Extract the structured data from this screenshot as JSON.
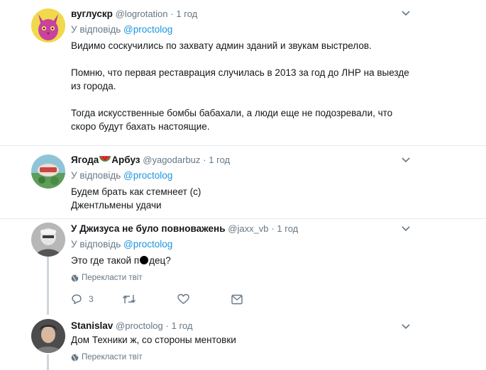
{
  "tweets": [
    {
      "name": "вуглускр",
      "handle": "@logrotation",
      "time": "1 год",
      "reply_prefix": "У відповідь",
      "reply_to": "@proctolog",
      "paragraphs": [
        "Видимо соскучились по захвату админ зданий и звукам выстрелов.",
        "Помню, что первая реставрация случилась в 2013 за год до ЛНР на выезде из города.",
        "Тогда искусственные бомбы бабахали, а люди еще не подозревали, что скоро будут бахать настоящие."
      ]
    },
    {
      "name_part1": "Ягода",
      "name_part2": "Арбуз",
      "handle": "@yagodarbuz",
      "time": "1 год",
      "reply_prefix": "У відповідь",
      "reply_to": "@proctolog",
      "lines": [
        "Будем брать как стемнеет (с)",
        "Джентльмены удачи"
      ]
    },
    {
      "name": "У Джизуса не було повноважень",
      "handle": "@jaxx_vb",
      "time": "1 год",
      "reply_prefix": "У відповідь",
      "reply_to": "@proctolog",
      "text_before": "Это где такой п",
      "text_after": "дец?",
      "translate": "Перекласти твіт",
      "reply_count": "3"
    },
    {
      "name": "Stanislav",
      "handle": "@proctolog",
      "time": "1 год",
      "text": "Дом Техники ж, со стороны ментовки",
      "translate": "Перекласти твіт"
    }
  ],
  "separator": "·",
  "colors": {
    "link": "#1b95e0",
    "muted": "#657786",
    "thread": "#ccd6dd"
  },
  "icons": [
    "chevron-down-icon",
    "globe-icon",
    "reply-icon",
    "retweet-icon",
    "like-icon",
    "message-icon"
  ]
}
